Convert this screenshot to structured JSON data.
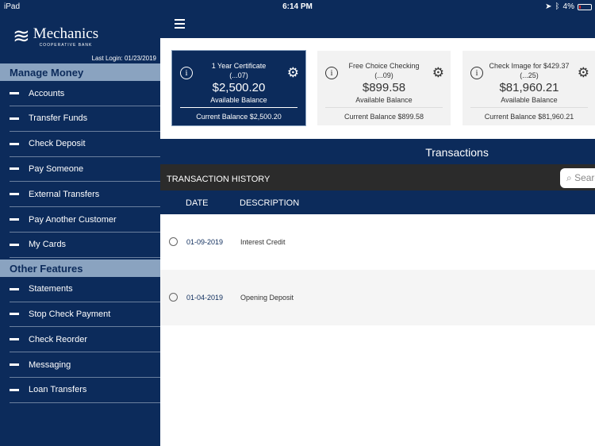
{
  "status": {
    "device": "iPad",
    "time": "6:14 PM",
    "battery": "4%"
  },
  "sidebar": {
    "brand": "Mechanics",
    "brand_sub": "COOPERATIVE BANK",
    "last_login": "Last Login:  01/23/2019",
    "sections": [
      {
        "title": "Manage Money",
        "items": [
          "Accounts",
          "Transfer Funds",
          "Check Deposit",
          "Pay Someone",
          "External Transfers",
          "Pay Another Customer",
          "My Cards"
        ]
      },
      {
        "title": "Other Features",
        "items": [
          "Statements",
          "Stop Check Payment",
          "Check Reorder",
          "Messaging",
          "Loan Transfers"
        ]
      }
    ]
  },
  "accounts": [
    {
      "name": "1 Year Certificate",
      "num": "(...07)",
      "amount": "$2,500.20",
      "avail_label": "Available Balance",
      "current": "Current Balance $2,500.20"
    },
    {
      "name": "Free Choice Checking",
      "num": "(...09)",
      "amount": "$899.58",
      "avail_label": "Available Balance",
      "current": "Current Balance $899.58"
    },
    {
      "name": "Check Image for $429.37",
      "num": "(...25)",
      "amount": "$81,960.21",
      "avail_label": "Available Balance",
      "current": "Current Balance $81,960.21"
    }
  ],
  "transactions": {
    "title": "Transactions",
    "history_label": "TRANSACTION HISTORY",
    "search_placeholder": "Search",
    "columns": [
      "DATE",
      "DESCRIPTION"
    ],
    "rows": [
      {
        "date": "01-09-2019",
        "description": "Interest Credit"
      },
      {
        "date": "01-04-2019",
        "description": "Opening Deposit"
      }
    ]
  }
}
